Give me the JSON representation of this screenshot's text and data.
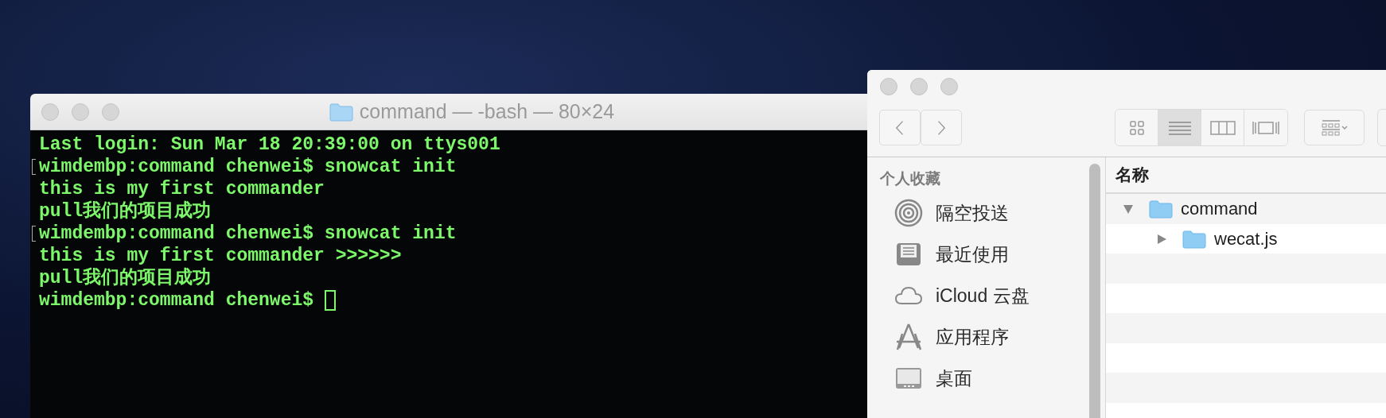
{
  "terminal": {
    "title": "command — -bash — 80×24",
    "lines": [
      {
        "text": "Last login: Sun Mar 18 20:39:00 on ttys001",
        "marked": false,
        "cursor": false
      },
      {
        "text": "wimdembp:command chenwei$ snowcat init",
        "marked": true,
        "cursor": false
      },
      {
        "text": "this is my first commander",
        "marked": false,
        "cursor": false
      },
      {
        "text": "pull我们的项目成功",
        "marked": false,
        "cursor": false
      },
      {
        "text": "wimdembp:command chenwei$ snowcat init",
        "marked": true,
        "cursor": false
      },
      {
        "text": "this is my first commander >>>>>>",
        "marked": false,
        "cursor": false
      },
      {
        "text": "pull我们的项目成功",
        "marked": false,
        "cursor": false
      },
      {
        "text": "wimdembp:command chenwei$ ",
        "marked": false,
        "cursor": true
      }
    ]
  },
  "finder": {
    "views": [
      {
        "kind": "icon",
        "selected": false
      },
      {
        "kind": "list",
        "selected": true
      },
      {
        "kind": "column",
        "selected": false
      },
      {
        "kind": "gallery",
        "selected": false
      }
    ],
    "sidebar": {
      "heading": "个人收藏",
      "items": [
        {
          "label": "隔空投送",
          "kind": "airdrop"
        },
        {
          "label": "最近使用",
          "kind": "recents"
        },
        {
          "label": "iCloud 云盘",
          "kind": "cloud"
        },
        {
          "label": "应用程序",
          "kind": "apps"
        },
        {
          "label": "桌面",
          "kind": "desktop"
        }
      ]
    },
    "column_header": "名称",
    "rows": [
      {
        "name": "command",
        "expanded": true,
        "children": [
          {
            "name": "wecat.js",
            "expanded": false
          }
        ]
      }
    ]
  }
}
